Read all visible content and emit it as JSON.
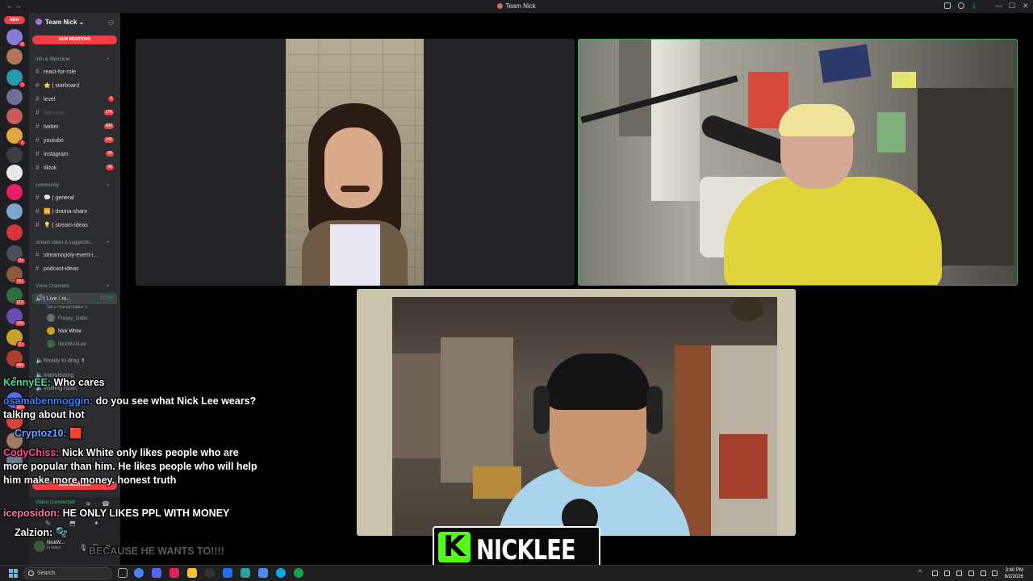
{
  "window": {
    "title": "Team Nick"
  },
  "rail": {
    "new_label": "NEW"
  },
  "sidebar": {
    "guild_name": "Team Nick ⌄",
    "new_mentions": "NEW MENTIONS",
    "categories": {
      "info": "Info & Welcome",
      "community": "community",
      "stream_ideas": "stream ideas & suggestio...",
      "voice": "Voice Channels"
    },
    "channels": [
      {
        "label": "react-for-role",
        "count": ""
      },
      {
        "label": "⭐ | starboard",
        "count": ""
      },
      {
        "label": "level",
        "count": "4"
      },
      {
        "label": "live-now",
        "count": "278"
      },
      {
        "label": "twitter",
        "count": "489"
      },
      {
        "label": "youtube",
        "count": "146"
      },
      {
        "label": "instagram",
        "count": "96"
      },
      {
        "label": "tiktok",
        "count": "46"
      },
      {
        "label": "💬 | general",
        "count": ""
      },
      {
        "label": "🆚 | drama-share",
        "count": ""
      },
      {
        "label": "💡 | stream-ideas",
        "count": ""
      },
      {
        "label": "streamopoly-event-i...",
        "count": ""
      },
      {
        "label": "podcast-ideas",
        "count": ""
      }
    ],
    "voice": {
      "live_channel": "| Live / m...",
      "live_timer": "17:18",
      "status_hint": "Set a channel status ✎",
      "users": [
        "Freaky_Gabe.",
        "Nick White",
        "NickWickLee"
      ],
      "ready": "Ready to drag ⬆",
      "interviewing": "Interviewing",
      "waiting": "Waiting room"
    },
    "bottom": {
      "video_connected": "Video Connected",
      "username": "NickW...",
      "user_status": "In voice"
    }
  },
  "chat": [
    {
      "name": "KennyEE:",
      "text": " Who cares"
    },
    {
      "name": "osamabenmoggin:",
      "text": " do you see what Nick Lee wears? talking about hot"
    },
    {
      "name": "Cryptoz10:",
      "text": " 🟥"
    },
    {
      "name": "CodyChiss:",
      "text": " Nick White only likes people who are more popular than him. He likes people who will help him make more money. honest truth"
    },
    {
      "name": "iceposidon:",
      "text": " HE ONLY LIKES PPL WITH MONEY"
    },
    {
      "name": "Zalzion:",
      "text": " 🫧"
    },
    {
      "name": "",
      "text": "BECAUSE HE WANTS TO!!!!"
    }
  ],
  "nametag": {
    "k": "K",
    "name": "NICKLEE"
  },
  "taskbar": {
    "search_placeholder": "Search",
    "time": "3:40 PM",
    "date": "8/2/2026"
  },
  "colors": {
    "accent_green": "#3ba55c",
    "kick_green": "#53fc18",
    "discord_red": "#f23f43"
  }
}
